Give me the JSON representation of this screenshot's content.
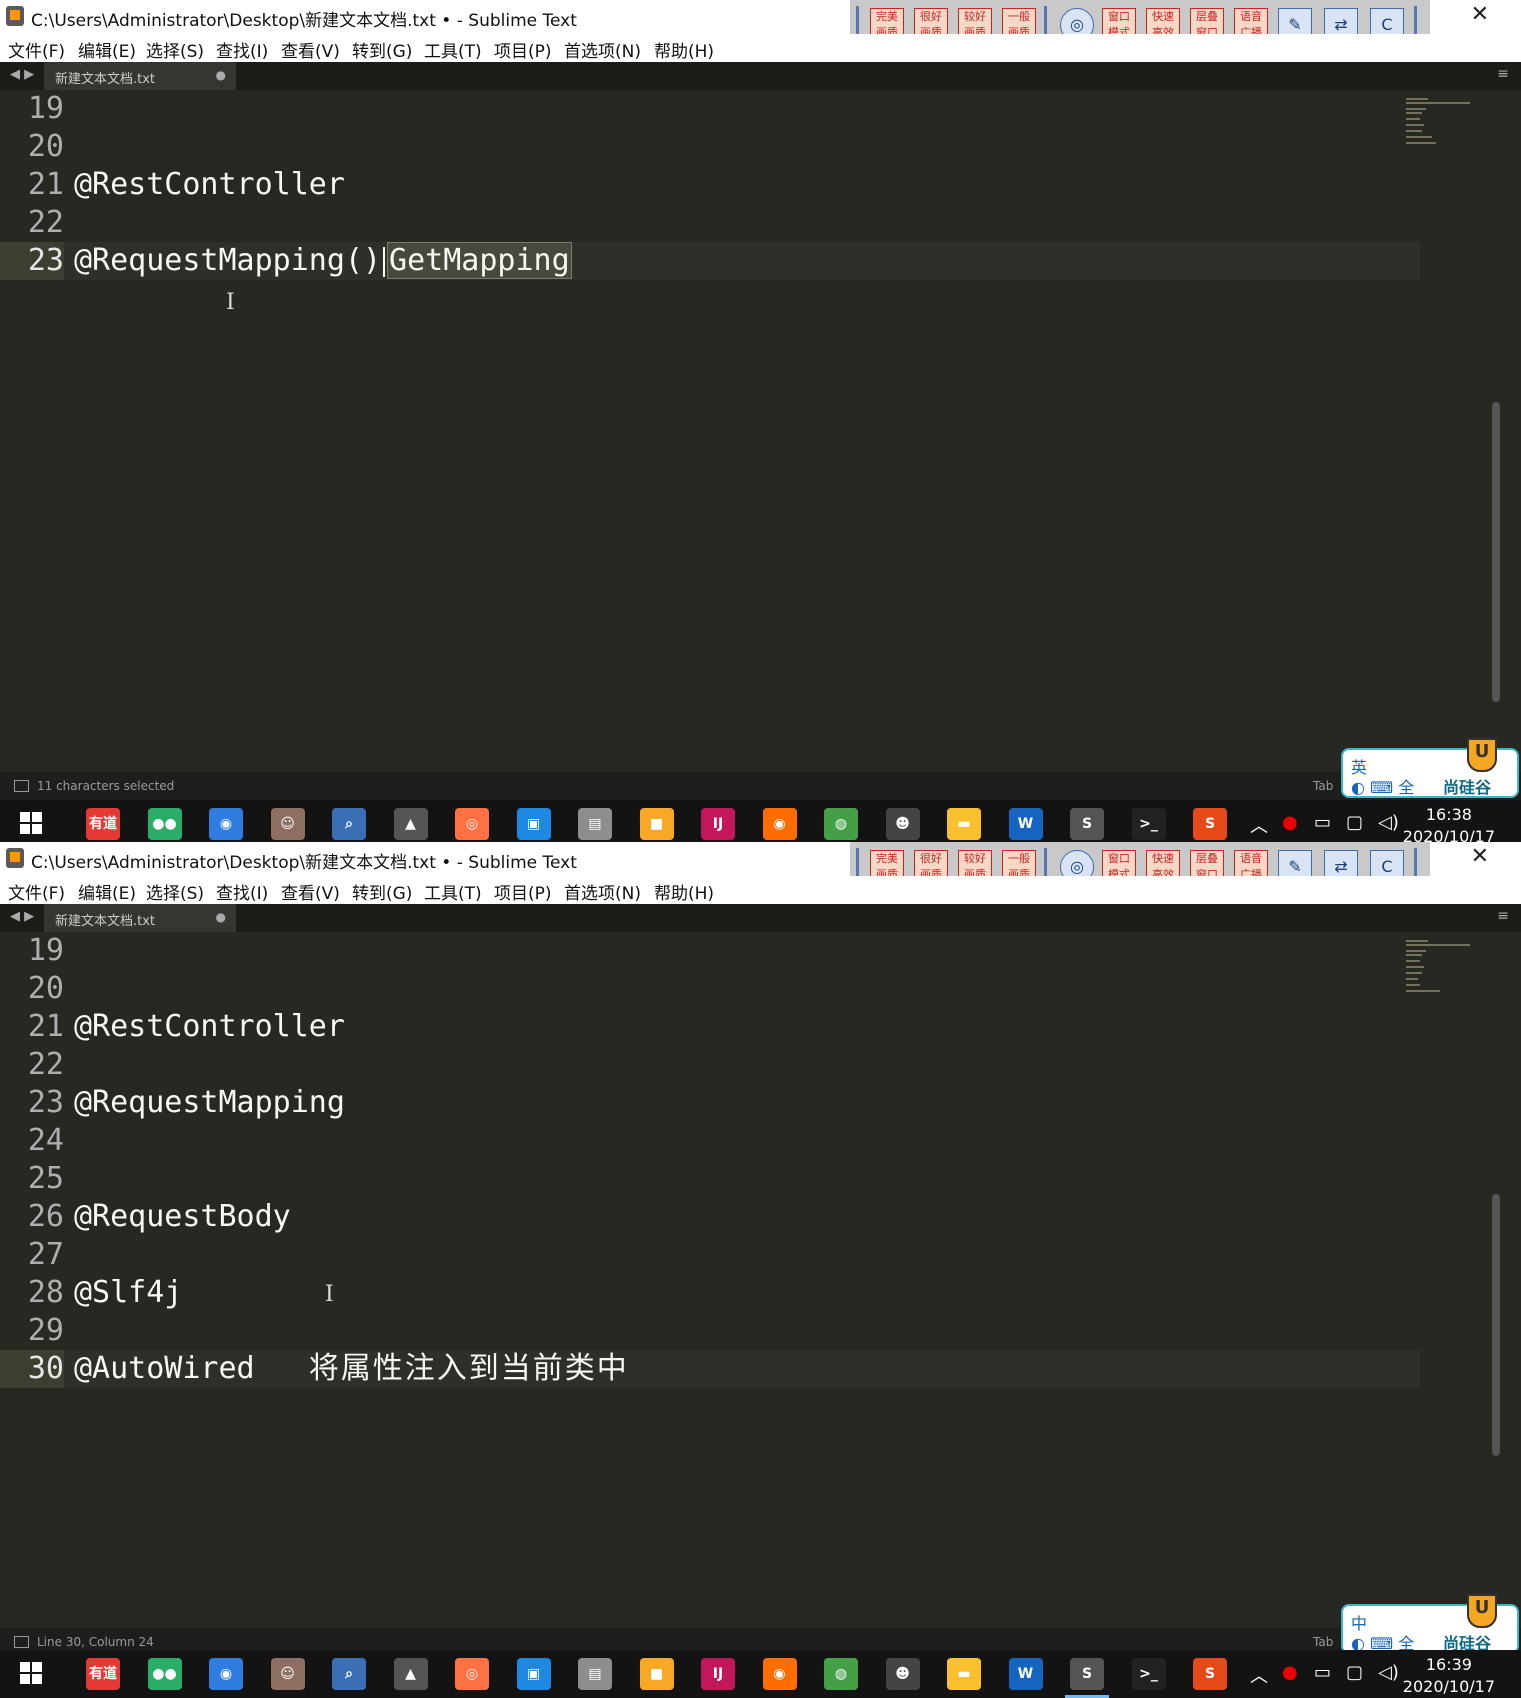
{
  "title": "C:\\Users\\Administrator\\Desktop\\新建文本文档.txt • - Sublime Text",
  "menu": [
    "文件(F)",
    "编辑(E)",
    "选择(S)",
    "查找(I)",
    "查看(V)",
    "转到(G)",
    "工具(T)",
    "项目(P)",
    "首选项(N)",
    "帮助(H)"
  ],
  "toolbar": [
    "完美画质",
    "很好画质",
    "较好画质",
    "一般画质",
    "窗口模式",
    "快速高效",
    "层叠窗口",
    "语音广播"
  ],
  "tab_label": "新建文本文档.txt",
  "panel1": {
    "lines": [
      {
        "num": "19",
        "code": ""
      },
      {
        "num": "20",
        "code": ""
      },
      {
        "num": "21",
        "code": "@RestController"
      },
      {
        "num": "22",
        "code": ""
      },
      {
        "num": "23",
        "code": "@RequestMapping()",
        "selected": "GetMapping",
        "current": true
      }
    ],
    "status": "11 characters selected",
    "status_right": "Tab",
    "ime": {
      "mode": "英",
      "row2": "全",
      "brand": "尚硅谷"
    },
    "clock_time": "16:38",
    "clock_date": "2020/10/17"
  },
  "panel2": {
    "lines": [
      {
        "num": "19",
        "code": ""
      },
      {
        "num": "20",
        "code": ""
      },
      {
        "num": "21",
        "code": "@RestController"
      },
      {
        "num": "22",
        "code": ""
      },
      {
        "num": "23",
        "code": "@RequestMapping"
      },
      {
        "num": "24",
        "code": ""
      },
      {
        "num": "25",
        "code": ""
      },
      {
        "num": "26",
        "code": "@RequestBody"
      },
      {
        "num": "27",
        "code": ""
      },
      {
        "num": "28",
        "code": "@Slf4j"
      },
      {
        "num": "29",
        "code": ""
      },
      {
        "num": "30",
        "code": "@AutoWired",
        "comment": "将属性注入到当前类中",
        "current": true
      }
    ],
    "status": "Line 30, Column 24",
    "status_right": "Tab",
    "ime": {
      "mode": "中",
      "row2": "全",
      "brand": "尚硅谷"
    },
    "clock_time": "16:39",
    "clock_date": "2020/10/17"
  },
  "taskbar_apps": [
    {
      "name": "youdao-app",
      "label": "有道",
      "color": "#e53935"
    },
    {
      "name": "wechat-app",
      "label": "●●",
      "color": "#2aae67"
    },
    {
      "name": "baidu-netdisk-app",
      "label": "◉",
      "color": "#2f7de1"
    },
    {
      "name": "avatar-app",
      "label": "☺",
      "color": "#8d6e63"
    },
    {
      "name": "search-tool-app",
      "label": "⌕",
      "color": "#3a6fb5"
    },
    {
      "name": "camera-app",
      "label": "▲",
      "color": "#555555"
    },
    {
      "name": "browser-app",
      "label": "◎",
      "color": "#ff7043"
    },
    {
      "name": "copy-tool-app",
      "label": "▣",
      "color": "#1e88e5"
    },
    {
      "name": "photo-app",
      "label": "▤",
      "color": "#8d8d8d"
    },
    {
      "name": "maps-app",
      "label": "■",
      "color": "#f9a825"
    },
    {
      "name": "intellij-app",
      "label": "IJ",
      "color": "#c2185b"
    },
    {
      "name": "firefox-app",
      "label": "◉",
      "color": "#ff6d00"
    },
    {
      "name": "chrome-app",
      "label": "◍",
      "color": "#43a047"
    },
    {
      "name": "emoji-app",
      "label": "☻",
      "color": "#444444"
    },
    {
      "name": "explorer-app",
      "label": "▬",
      "color": "#fbc02d"
    },
    {
      "name": "word-app",
      "label": "W",
      "color": "#1565c0"
    },
    {
      "name": "sublime-app",
      "label": "S",
      "color": "#555555",
      "active": true
    },
    {
      "name": "terminal-app",
      "label": ">_",
      "color": "#222222"
    },
    {
      "name": "sogou-app",
      "label": "S",
      "color": "#e64a19"
    }
  ],
  "tray_icons": [
    "chevron-up-icon",
    "record-icon",
    "battery-icon",
    "network-icon",
    "volume-icon"
  ]
}
